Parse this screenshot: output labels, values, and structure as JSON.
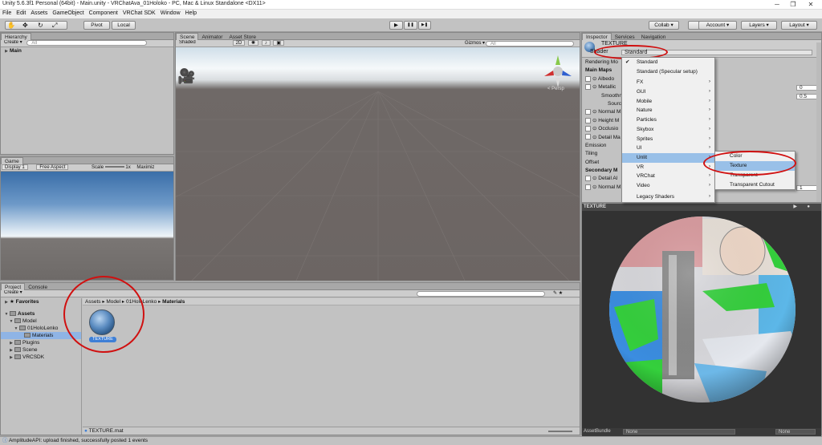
{
  "window": {
    "title": "Unity 5.6.3f1 Personal (64bit) - Main.unity - VRChatAva_01Holoko - PC, Mac & Linux Standalone <DX11>",
    "minimize": "─",
    "maximize": "❐",
    "close": "✕"
  },
  "menu": [
    "File",
    "Edit",
    "Assets",
    "GameObject",
    "Component",
    "VRChat SDK",
    "Window",
    "Help"
  ],
  "toolbar": {
    "pivot": "Pivot",
    "local": "Local",
    "collab": "Collab ▾",
    "account": "Account ▾",
    "layers": "Layers ▾",
    "layout": "Layout ▾",
    "play": "▶",
    "pause": "❚❚",
    "step": "▶❚"
  },
  "hierarchy": {
    "tab": "Hierarchy",
    "create": "Create ▾",
    "search": "All",
    "root": "Main"
  },
  "game": {
    "tab": "Game",
    "display": "Display 1",
    "aspect": "Free Aspect",
    "scale_label": "Scale",
    "scale_value": "1x",
    "maximize": "Maximiz"
  },
  "scene": {
    "tabs": [
      "Scene",
      "Animator",
      "Asset Store"
    ],
    "shaded": "Shaded",
    "mode2d": "2D",
    "gizmos": "Gizmos ▾",
    "search": "All",
    "persp": "< Persp"
  },
  "project": {
    "tabs": [
      "Project",
      "Console"
    ],
    "create": "Create ▾",
    "favorites": "Favorites",
    "assets": "Assets",
    "tree": [
      {
        "label": "Model",
        "indent": 1
      },
      {
        "label": "01HoloLenko",
        "indent": 2
      },
      {
        "label": "Materials",
        "indent": 3
      },
      {
        "label": "Plugins",
        "indent": 1
      },
      {
        "label": "Scene",
        "indent": 1
      },
      {
        "label": "VRCSDK",
        "indent": 1
      }
    ],
    "breadcrumb": [
      "Assets",
      "Model",
      "01HoloLenko",
      "Materials"
    ],
    "asset_name": "TEXTURE",
    "footer_file": "TEXTURE.mat"
  },
  "inspector": {
    "tabs": [
      "Inspector",
      "Services",
      "Navigation"
    ],
    "material_name": "TEXTURE",
    "shader_label": "Shader",
    "shader_value": "Standard",
    "rows": [
      {
        "text": "Rendering Mo",
        "kind": "plain"
      },
      {
        "text": "Main Maps",
        "kind": "bold"
      },
      {
        "text": "Albedo",
        "kind": "map"
      },
      {
        "text": "Metallic",
        "kind": "map",
        "value": "0"
      },
      {
        "text": "Smoothn",
        "kind": "sub",
        "value": "0.5"
      },
      {
        "text": "Sourc",
        "kind": "sub2"
      },
      {
        "text": "Normal M",
        "kind": "map"
      },
      {
        "text": "Height M",
        "kind": "map"
      },
      {
        "text": "Occlusio",
        "kind": "map"
      },
      {
        "text": "Detail Ma",
        "kind": "map"
      },
      {
        "text": "Emission",
        "kind": "plain"
      },
      {
        "text": "Tiling",
        "kind": "plain"
      },
      {
        "text": "Offset",
        "kind": "plain"
      },
      {
        "text": "Secondary M",
        "kind": "bold"
      },
      {
        "text": "Detail Al",
        "kind": "map"
      },
      {
        "text": "Normal M",
        "kind": "map",
        "value": "1"
      }
    ],
    "preview_title": "TEXTURE",
    "assetbundle_label": "AssetBundle",
    "assetbundle_value": "None",
    "assetbundle_value2": "None"
  },
  "shader_menu": {
    "items": [
      "Standard",
      "Standard (Specular setup)",
      "FX",
      "GUI",
      "Mobile",
      "Nature",
      "Particles",
      "Skybox",
      "Sprites",
      "UI",
      "Unlit",
      "VR",
      "VRChat",
      "Video",
      "Legacy Shaders"
    ],
    "checked": "Standard",
    "highlighted": "Unlit",
    "submenu_items": [
      "Color",
      "Texture",
      "Transparent",
      "Transparent Cutout"
    ],
    "submenu_highlighted": "Texture"
  },
  "status": "AmplitudeAPI: upload finished, successfully posted 1 events",
  "colors": {
    "accent": "#3e7fd6",
    "annotation": "#d01010",
    "selection": "#8fb4e5"
  }
}
